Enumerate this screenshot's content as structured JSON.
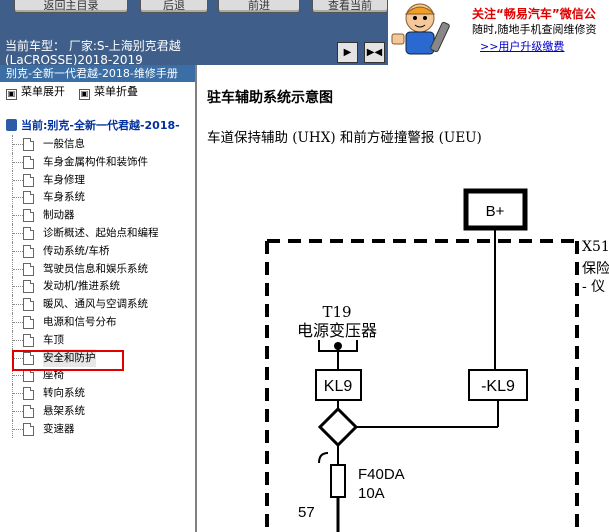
{
  "toolbar": {
    "buttons": [
      "返回主目录",
      "后退",
      "前进",
      "查看当前"
    ]
  },
  "wechat": {
    "line1": "关注“畅易汽车”微信公",
    "line2": "随时,随地手机查阅维修资",
    "link": ">>用户升级缴费"
  },
  "model": {
    "text": "当前车型： 厂家:S-上海别克君越(LaCROSSE)2018-2019"
  },
  "nav": {
    "prev_icon": "arrow-right-icon",
    "sync_icon": "sync-arrows-icon"
  },
  "left_panel": {
    "manual_title": "别克-全新一代君越-2018-维修手册",
    "expand_label": "菜单展开",
    "collapse_label": "菜单折叠",
    "root_label": "当前:别克-全新一代君越-2018-",
    "items": [
      "一般信息",
      "车身金属构件和装饰件",
      "车身修理",
      "车身系统",
      "制动器",
      "诊断概述、起始点和编程",
      "传动系统/车桥",
      "驾驶员信息和娱乐系统",
      "发动机/推进系统",
      "暖风、通风与空调系统",
      "电源和信号分布",
      "车顶",
      "安全和防护",
      "座椅",
      "转向系统",
      "悬架系统",
      "变速器"
    ],
    "selected_index": 12
  },
  "main": {
    "title": "驻车辅助系统示意图",
    "subtitle": "车道保持辅助 (UHX) 和前方碰撞警报 (UEU)"
  },
  "diagram": {
    "battery_label": "B+",
    "module_id": "X51",
    "module_line2": "保险",
    "module_line3": "- 仪",
    "transformer_id": "T19",
    "transformer_name": "电源变压器",
    "relay_left": "KL9",
    "relay_right": "-KL9",
    "fuse_id": "F40DA",
    "fuse_rating": "10A",
    "wire_num": "57"
  }
}
